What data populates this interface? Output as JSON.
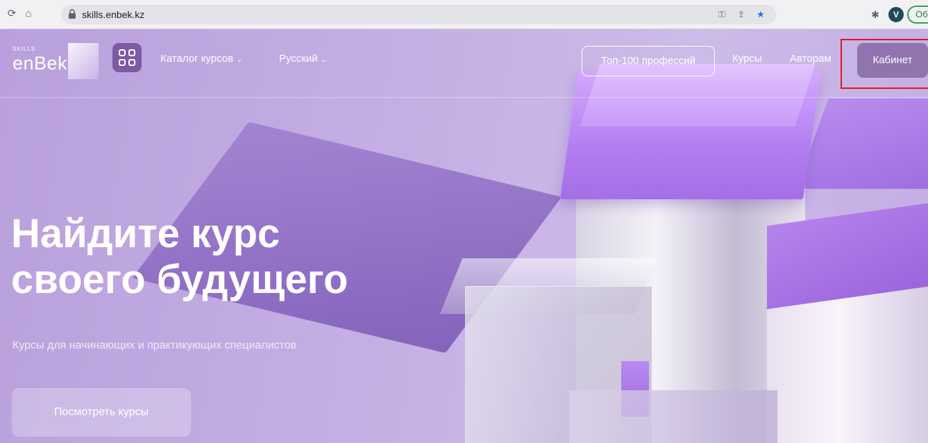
{
  "browser": {
    "url": "skills.enbek.kz",
    "profile_initial": "V",
    "update_label": "Об"
  },
  "site": {
    "logo_small": "SKILLS",
    "logo_text": "enBek",
    "nav": {
      "catalog": "Каталог курсов",
      "language": "Русский",
      "top100": "Топ-100 профессий",
      "courses": "Курсы",
      "authors": "Авторам",
      "cabinet": "Кабинет"
    },
    "hero": {
      "title_line1": "Найдите курс",
      "title_line2": "своего будущего",
      "subtitle": "Курсы для начинающих и практикующих специалистов",
      "cta": "Посмотреть курсы"
    }
  },
  "colors": {
    "hero_bg": "#c6b0e3",
    "accent": "#7c5aa4",
    "highlight": "#e0161f"
  }
}
